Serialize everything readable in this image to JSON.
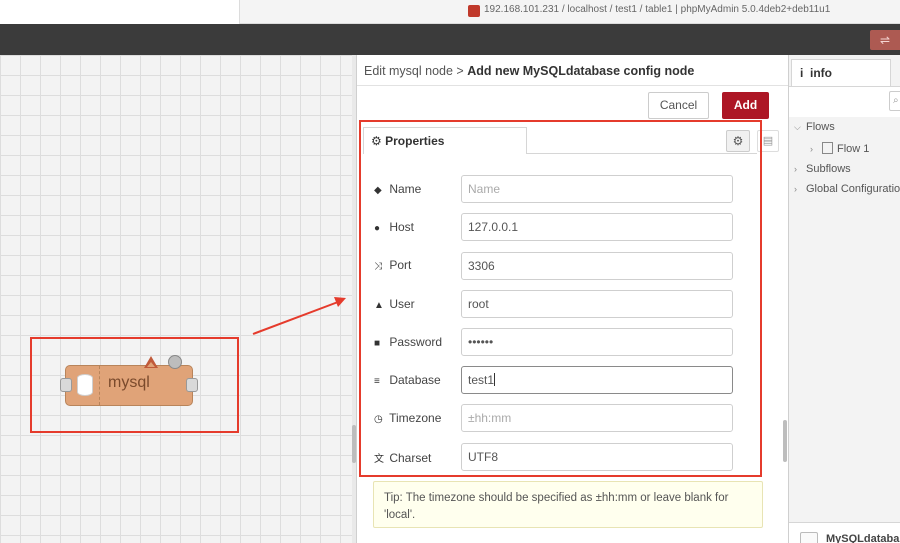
{
  "browser": {
    "url": "192.168.101.231 / localhost / test1 / table1 | phpMyAdmin 5.0.4deb2+deb11u1"
  },
  "header": {
    "deploy_icon": "deploy-icon"
  },
  "canvas": {
    "node_label": "mysql",
    "node_icon": "database-icon"
  },
  "tray": {
    "breadcrumb": "Edit mysql node",
    "separator": ">",
    "title": "Add new MySQLdatabase config node",
    "cancel_label": "Cancel",
    "add_label": "Add",
    "tab_label": "Properties",
    "fields": {
      "name": {
        "label": "Name",
        "placeholder": "Name",
        "value": ""
      },
      "host": {
        "label": "Host",
        "value": "127.0.0.1"
      },
      "port": {
        "label": "Port",
        "value": "3306"
      },
      "user": {
        "label": "User",
        "value": "root"
      },
      "password": {
        "label": "Password",
        "value": "••••••"
      },
      "database": {
        "label": "Database",
        "value": "test1"
      },
      "timezone": {
        "label": "Timezone",
        "placeholder": "±hh:mm",
        "value": ""
      },
      "charset": {
        "label": "Charset",
        "value": "UTF8"
      }
    },
    "tip": "Tip: The timezone should be specified as ±hh:mm or leave blank for 'local'."
  },
  "sidebar": {
    "tab_label": "info",
    "tree": {
      "flows": "Flows",
      "flow1": "Flow 1",
      "subflows": "Subflows",
      "global_config": "Global Configuration"
    },
    "bottom_label": "MySQLdatabase"
  },
  "colors": {
    "accent_red": "#ad1625",
    "highlight_box": "#e53b2c",
    "node_fill": "#e0a378",
    "header_bg": "#3b3b3b"
  }
}
